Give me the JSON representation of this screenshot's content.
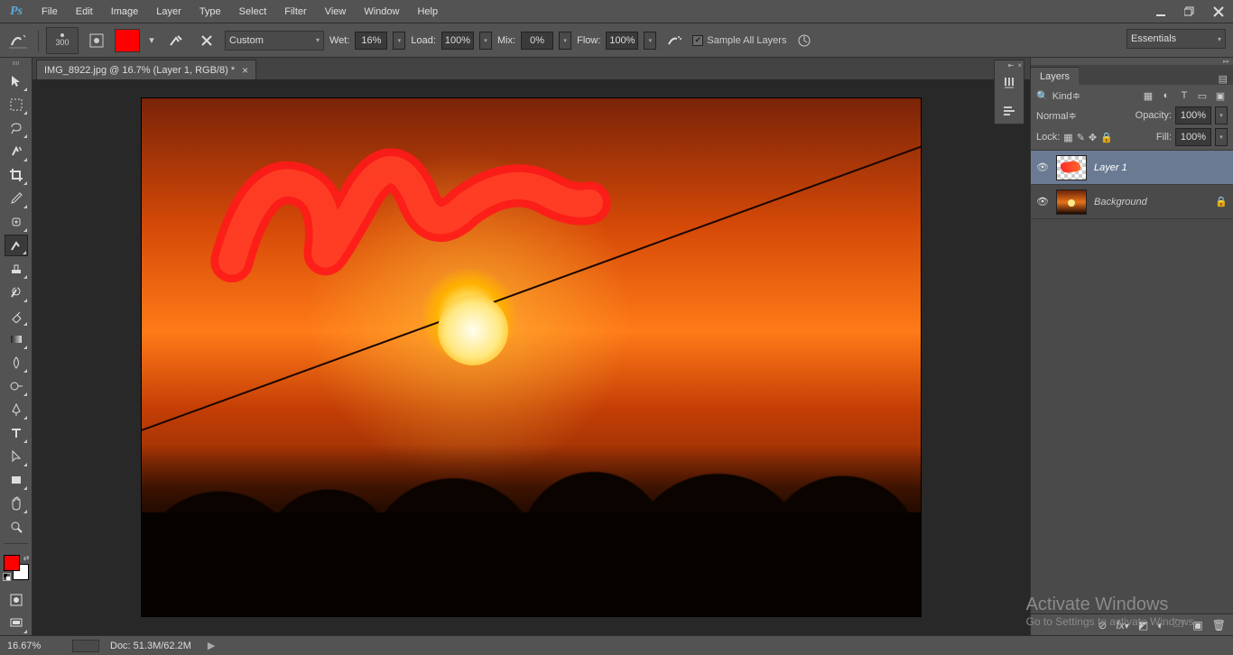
{
  "app": {
    "logo_text": "Ps"
  },
  "menu": [
    "File",
    "Edit",
    "Image",
    "Layer",
    "Type",
    "Select",
    "Filter",
    "View",
    "Window",
    "Help"
  ],
  "options": {
    "brush_size": "300",
    "swatch_color": "#ff0000",
    "preset": "Custom",
    "wet_label": "Wet:",
    "wet_value": "16%",
    "load_label": "Load:",
    "load_value": "100%",
    "mix_label": "Mix:",
    "mix_value": "0%",
    "flow_label": "Flow:",
    "flow_value": "100%",
    "sample_label": "Sample All Layers",
    "workspace": "Essentials"
  },
  "document": {
    "tab_title": "IMG_8922.jpg @ 16.7% (Layer 1, RGB/8) *"
  },
  "layers_panel": {
    "title": "Layers",
    "filter_kind": "Kind",
    "blend_mode": "Normal",
    "opacity_label": "Opacity:",
    "opacity_value": "100%",
    "lock_label": "Lock:",
    "fill_label": "Fill:",
    "fill_value": "100%",
    "layers": [
      {
        "name": "Layer 1",
        "locked": false,
        "selected": true,
        "thumb": "checker"
      },
      {
        "name": "Background",
        "locked": true,
        "selected": false,
        "thumb": "sunset"
      }
    ]
  },
  "status": {
    "zoom": "16.67%",
    "doc_info": "Doc: 51.3M/62.2M"
  },
  "watermark": {
    "line1": "Activate Windows",
    "line2": "Go to Settings to activate Windows."
  }
}
